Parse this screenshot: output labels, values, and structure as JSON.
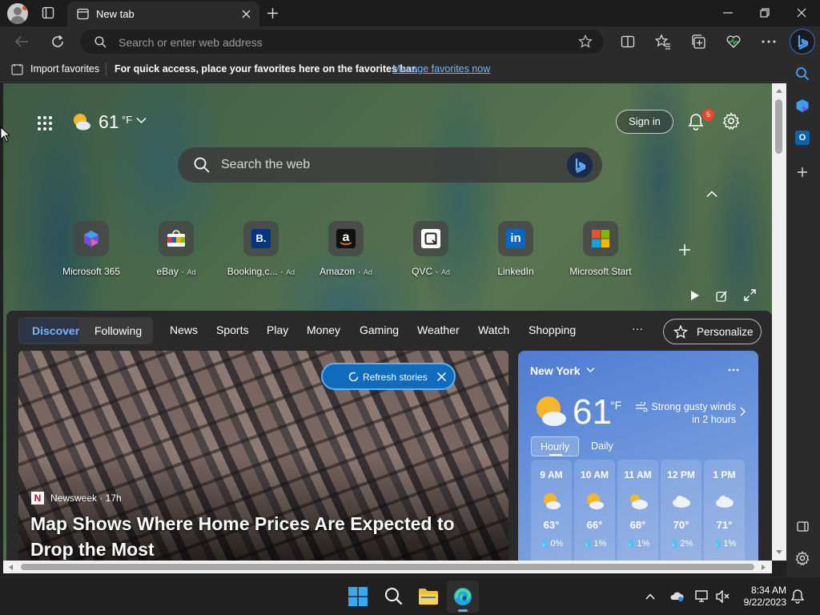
{
  "browser": {
    "tab_title": "New tab",
    "address_placeholder": "Search or enter web address"
  },
  "favorites_bar": {
    "import_label": "Import favorites",
    "message": "For quick access, place your favorites here on the favorites bar.",
    "manage_link": "Manage favorites now"
  },
  "newtab": {
    "weather_temp": "61",
    "weather_unit": "°F",
    "sign_in": "Sign in",
    "notification_count": "5",
    "search_placeholder": "Search the web",
    "tiles": [
      {
        "label": "Microsoft 365",
        "ad": ""
      },
      {
        "label": "eBay",
        "ad": "Ad"
      },
      {
        "label": "Booking,c...",
        "ad": "Ad"
      },
      {
        "label": "Amazon",
        "ad": "Ad"
      },
      {
        "label": "QVC",
        "ad": "Ad"
      },
      {
        "label": "LinkedIn",
        "ad": ""
      },
      {
        "label": "Microsoft Start",
        "ad": ""
      }
    ]
  },
  "feed": {
    "tabs": [
      "Discover",
      "Following"
    ],
    "categories": [
      "News",
      "Sports",
      "Play",
      "Money",
      "Gaming",
      "Weather",
      "Watch",
      "Shopping"
    ],
    "more": "···",
    "personalize": "Personalize",
    "refresh": "Refresh stories",
    "story": {
      "source": "Newsweek · 17h",
      "source_logo": "N",
      "headline": "Map Shows Where Home Prices Are Expected to Drop the Most"
    }
  },
  "weather_card": {
    "location": "New York",
    "temp": "61",
    "unit": "°F",
    "alert": "Strong gusty winds in 2 hours",
    "tab_hourly": "Hourly",
    "tab_daily": "Daily",
    "hours": [
      {
        "time": "9 AM",
        "temp": "63°",
        "precip": "0%",
        "icon": "partly-sunny-icon"
      },
      {
        "time": "10 AM",
        "temp": "66°",
        "precip": "1%",
        "icon": "partly-sunny-icon"
      },
      {
        "time": "11 AM",
        "temp": "68°",
        "precip": "1%",
        "icon": "partly-cloudy-icon"
      },
      {
        "time": "12 PM",
        "temp": "70°",
        "precip": "2%",
        "icon": "cloudy-icon"
      },
      {
        "time": "1 PM",
        "temp": "71°",
        "precip": "1%",
        "icon": "cloudy-icon"
      }
    ]
  },
  "taskbar": {
    "time": "8:34 AM",
    "date": "9/22/2023"
  },
  "colors": {
    "accent": "#0f6cbd",
    "link": "#6fb6ff",
    "notification_badge": "#e8472b"
  }
}
